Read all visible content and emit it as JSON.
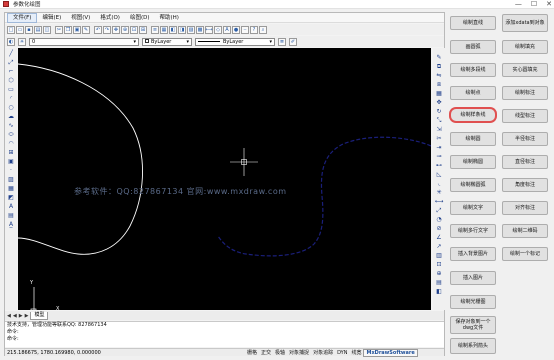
{
  "window": {
    "title": "参数化绘图",
    "controls": [
      "—",
      "☐",
      "✕"
    ]
  },
  "menu": [
    "文件(F)",
    "编辑(E)",
    "视图(V)",
    "格式(O)",
    "绘图(D)",
    "帮助(H)"
  ],
  "toolbar2": {
    "layer": "0",
    "color_value": "ByLayer",
    "linetype_value": "ByLayer"
  },
  "canvas": {
    "watermark": "参考软件：QQ:827867134  官网:www.mxdraw.com",
    "ucs_x": "X",
    "ucs_y": "Y"
  },
  "tabs": {
    "nav": [
      "◀",
      "◀",
      "▶",
      "▶"
    ],
    "items": [
      "模型"
    ]
  },
  "command": {
    "lines": [
      "技术支持，管理功能等联系QQ: 827867134",
      "命令:",
      "命令:"
    ]
  },
  "status": {
    "coords": "215.186675,  1780.169980,  0.000000",
    "buttons": [
      "栅格",
      "正交",
      "极轴",
      "对象捕捉",
      "对象追踪",
      "DYN",
      "线宽"
    ],
    "brand": "MxDrawSoftware"
  },
  "panel": {
    "buttons": [
      "绘制直线",
      "添加xdata到对象",
      "画圆弧",
      "绘制填充",
      "绘制多段线",
      "实心圆填充",
      "绘制点",
      "绘制标注",
      "绘制样条线",
      "线型标注",
      "绘制圆",
      "半径标注",
      "绘制椭圆",
      "直径标注",
      "绘制椭圆弧",
      "角度标注",
      "绘制文字",
      "对齐标注",
      "绘制多行文字",
      "绘制二维码",
      "插入背景图片",
      "绘制一个标记",
      "插入图片",
      "绘制光栅图",
      "保存对象到一个dwg文件",
      "绘制系列箭头"
    ]
  },
  "colors": {
    "canvas_bg": "#000000",
    "curve_white": "#ffffff",
    "curve_blue": "#1a1f7a",
    "highlight": "#e05050"
  }
}
